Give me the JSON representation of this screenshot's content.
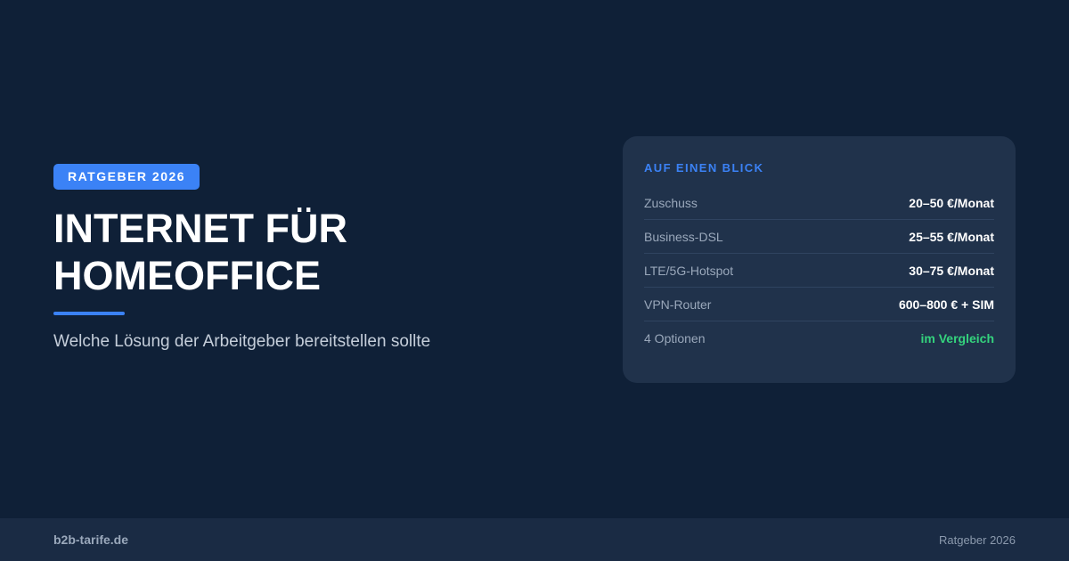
{
  "badge": "RATGEBER 2026",
  "title_line1": "INTERNET FÜR",
  "title_line2": "HOMEOFFICE",
  "subtitle": "Welche Lösung der Arbeitgeber bereitstellen sollte",
  "card": {
    "title": "AUF EINEN BLICK",
    "rows": [
      {
        "label": "Zuschuss",
        "value": "20–50 €/Monat"
      },
      {
        "label": "Business-DSL",
        "value": "25–55 €/Monat"
      },
      {
        "label": "LTE/5G-Hotspot",
        "value": "30–75 €/Monat"
      },
      {
        "label": "VPN-Router",
        "value": "600–800 € + SIM"
      },
      {
        "label": "4 Optionen",
        "value": "im Vergleich"
      }
    ]
  },
  "footer": {
    "domain": "b2b-tarife.de",
    "meta": "Ratgeber 2026"
  },
  "colors": {
    "background": "#0f2037",
    "accent": "#3b82f6",
    "card": "#20324b",
    "highlight": "#34d37d"
  }
}
